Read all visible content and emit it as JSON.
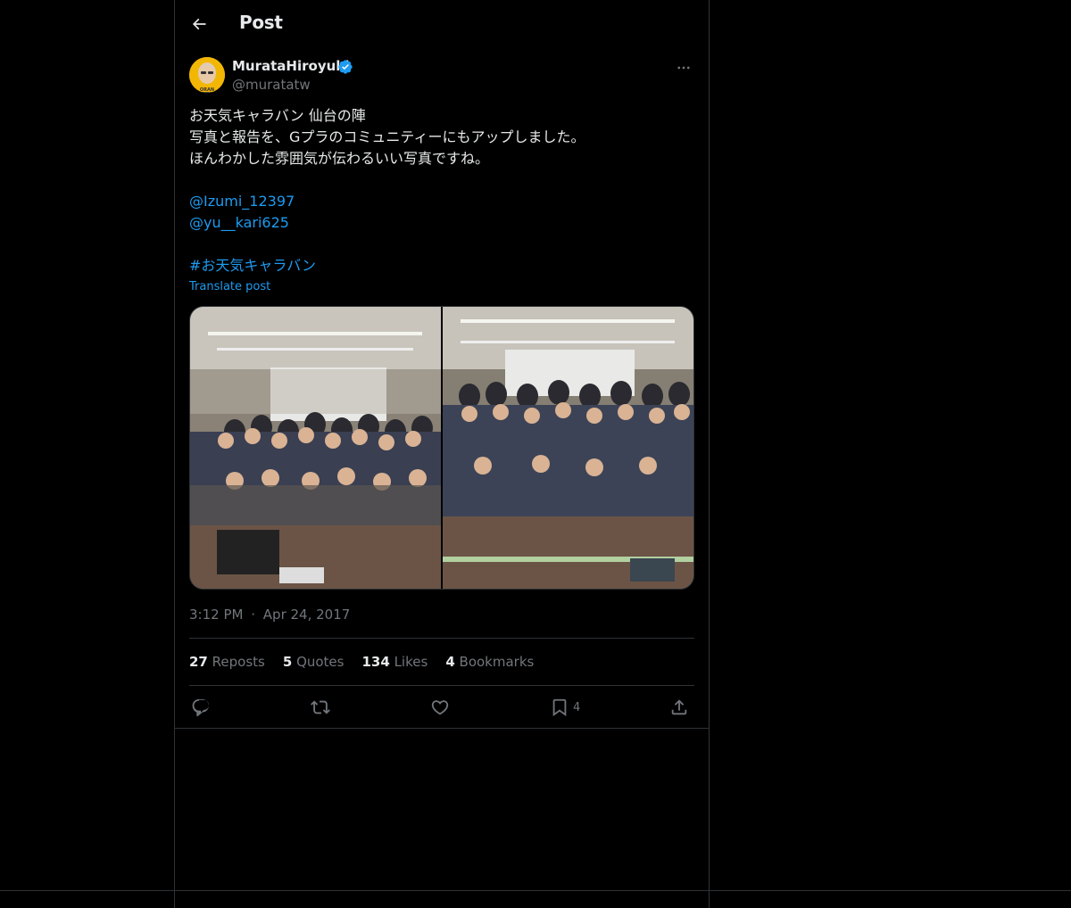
{
  "header": {
    "title": "Post",
    "back_icon": "arrow-left-icon"
  },
  "author": {
    "name": "MurataHiroyuki",
    "handle": "@muratatw",
    "verified_icon": "verified-badge-icon",
    "avatar_label": "ORAN"
  },
  "tweet": {
    "line1": "お天気キャラバン 仙台の陣",
    "line2": "写真と報告を、Gプラのコミュニティーにもアップしました。",
    "line3": "ほんわかした雰囲気が伝わるいい写真ですね。",
    "mention1": "@Izumi_12397",
    "mention2": "@yu__kari625",
    "hashtag": "#お天気キャラバン",
    "translate": "Translate post"
  },
  "meta": {
    "time": "3:12 PM",
    "separator": "·",
    "date": "Apr 24, 2017"
  },
  "stats": {
    "reposts_count": "27",
    "reposts_label": "Reposts",
    "quotes_count": "5",
    "quotes_label": "Quotes",
    "likes_count": "134",
    "likes_label": "Likes",
    "bookmarks_count": "4",
    "bookmarks_label": "Bookmarks"
  },
  "actions": {
    "bookmark_count": "4"
  },
  "colors": {
    "background": "#000000",
    "accent": "#1d9bf0",
    "text": "#e7e9ea",
    "muted": "#71767b",
    "border": "#2f3336"
  }
}
